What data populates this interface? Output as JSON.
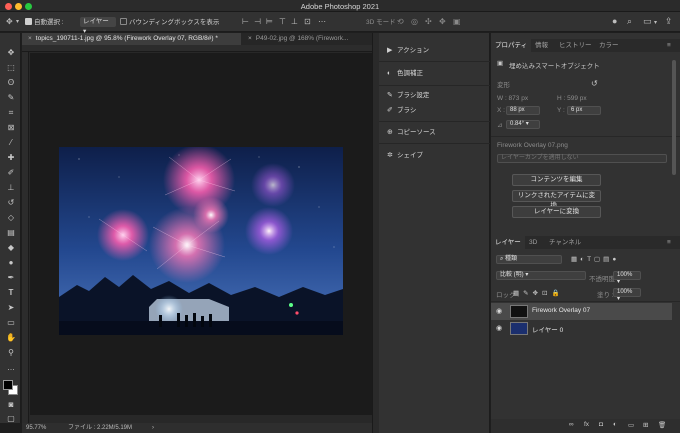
{
  "window": {
    "title": "Adobe Photoshop 2021",
    "traffic_colors": [
      "#fe5f57",
      "#febc2e",
      "#28c840"
    ]
  },
  "options_bar": {
    "auto_select_label": "自動選択 :",
    "auto_select_target": "レイヤー",
    "show_transform_label": "バウンディングボックスを表示",
    "mode_3d_label": "3D モード :"
  },
  "doc_tabs": [
    {
      "label": "topics_190711-1.jpg @ 95.8% (Firework Overlay 07, RGB/8#) *",
      "close": "×"
    },
    {
      "label": "P49-02.jpg @ 168% (Firework...",
      "close": "×"
    }
  ],
  "status_bar": {
    "zoom": "95.77%",
    "file_info": "ファイル : 2.22M/5.19M"
  },
  "mid_panel": {
    "items": [
      {
        "label": "アクション",
        "icon": "play-icon"
      },
      {
        "label": "色調補正",
        "icon": "adjust-icon"
      },
      {
        "label": "ブラシ設定",
        "icon": "brush-settings-icon"
      },
      {
        "label": "ブラシ",
        "icon": "brush-icon"
      },
      {
        "label": "コピーソース",
        "icon": "clone-source-icon"
      },
      {
        "label": "シェイプ",
        "icon": "shape-icon"
      }
    ]
  },
  "properties_panel": {
    "tabs": [
      "プロパティ",
      "情報",
      "ヒストリー",
      "カラー"
    ],
    "layer_type": "埋め込みスマートオブジェクト",
    "transform_label": "変形",
    "w_label": "W : 873 px",
    "h_label": "H : 599 px",
    "x_label": "X :",
    "x_value": "88 px",
    "y_label": "Y :",
    "y_value": "6 px",
    "angle_label": "⊿",
    "angle_value": "0.84°",
    "filename": "Firework Overlay 07.png",
    "layer_comp_placeholder": "レイヤーカンプを適用しない",
    "buttons": [
      "コンテンツを編集",
      "リンクされたアイテムに変換...",
      "レイヤーに変換"
    ]
  },
  "layers_panel": {
    "tabs": [
      "レイヤー",
      "3D",
      "チャンネル"
    ],
    "filter_label": "種類",
    "blend_mode": "比較 (明)",
    "opacity_label": "不透明度 :",
    "opacity_value": "100%",
    "lock_label": "ロック :",
    "fill_label": "塗り :",
    "fill_value": "100%",
    "layers": [
      {
        "name": "Firework Overlay 07",
        "selected": true,
        "thumb": "#111111"
      },
      {
        "name": "レイヤー 0",
        "selected": false,
        "thumb": "#1b2f6e"
      }
    ]
  },
  "tools": [
    "move-tool",
    "marquee-tool",
    "lasso-tool",
    "quick-select-tool",
    "crop-tool",
    "frame-tool",
    "eyedropper-tool",
    "healing-tool",
    "brush-tool",
    "stamp-tool",
    "history-brush-tool",
    "eraser-tool",
    "gradient-tool",
    "blur-tool",
    "dodge-tool",
    "pen-tool",
    "type-tool",
    "path-select-tool",
    "rectangle-tool",
    "hand-tool",
    "zoom-tool",
    "more-tools"
  ]
}
